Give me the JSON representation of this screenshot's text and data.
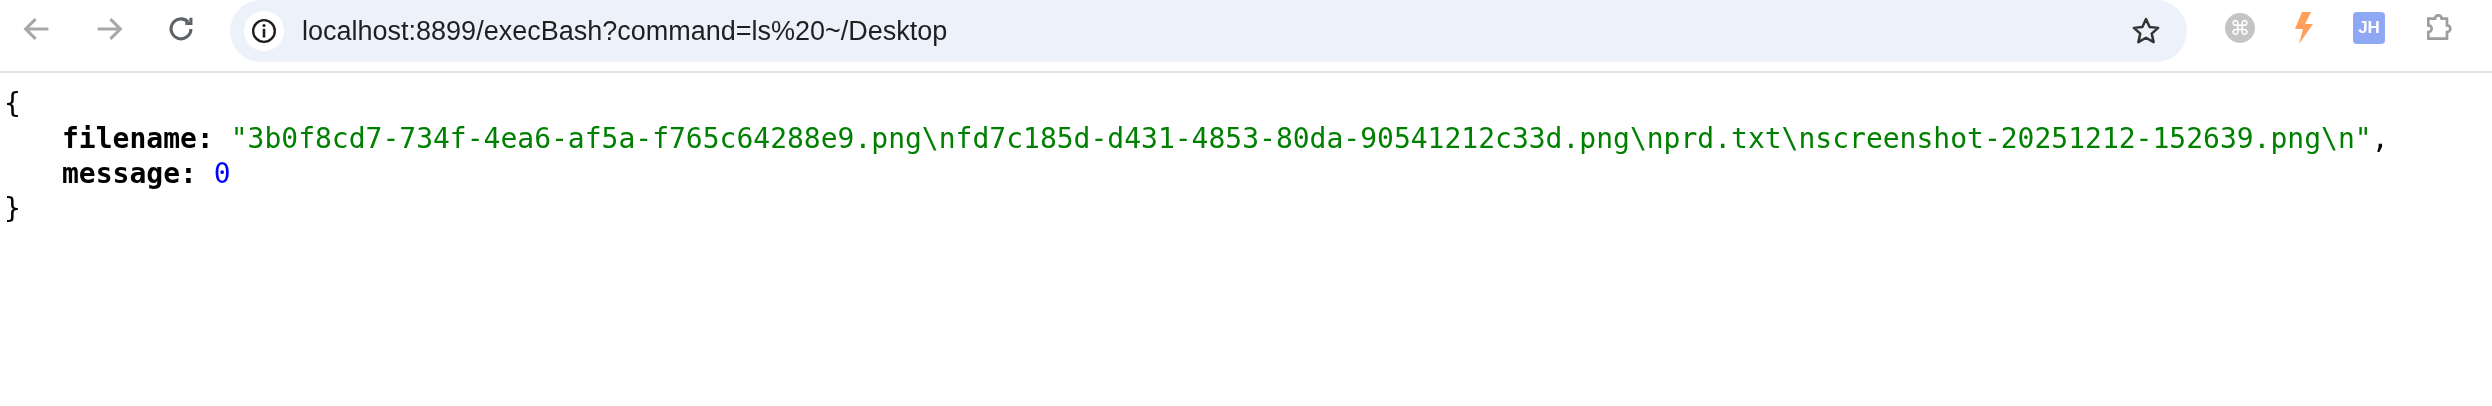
{
  "toolbar": {
    "nav": [
      {
        "kind": "back",
        "disabled": true
      },
      {
        "kind": "forward",
        "disabled": true
      },
      {
        "kind": "reload",
        "disabled": false
      }
    ],
    "address_bar": {
      "url": "localhost:8899/execBash?command=ls%20~/Desktop",
      "bookmarked": false
    },
    "extensions": [
      {
        "kind": "glyph",
        "label": "⌘"
      },
      {
        "kind": "bolt"
      },
      {
        "kind": "badge",
        "label": "JH"
      },
      {
        "kind": "puzzle"
      }
    ]
  },
  "json_view": {
    "open": "{",
    "fields": [
      {
        "key": "filename:",
        "kind": "string",
        "value": "\"3b0f8cd7-734f-4ea6-af5a-f765c64288e9.png\\nfd7c185d-d431-4853-80da-90541212c33d.png\\nprd.txt\\nscreenshot-20251212-152639.png\\n\"",
        "comma": ","
      },
      {
        "key": "message:",
        "kind": "number",
        "value": "0"
      }
    ],
    "close": "}"
  }
}
